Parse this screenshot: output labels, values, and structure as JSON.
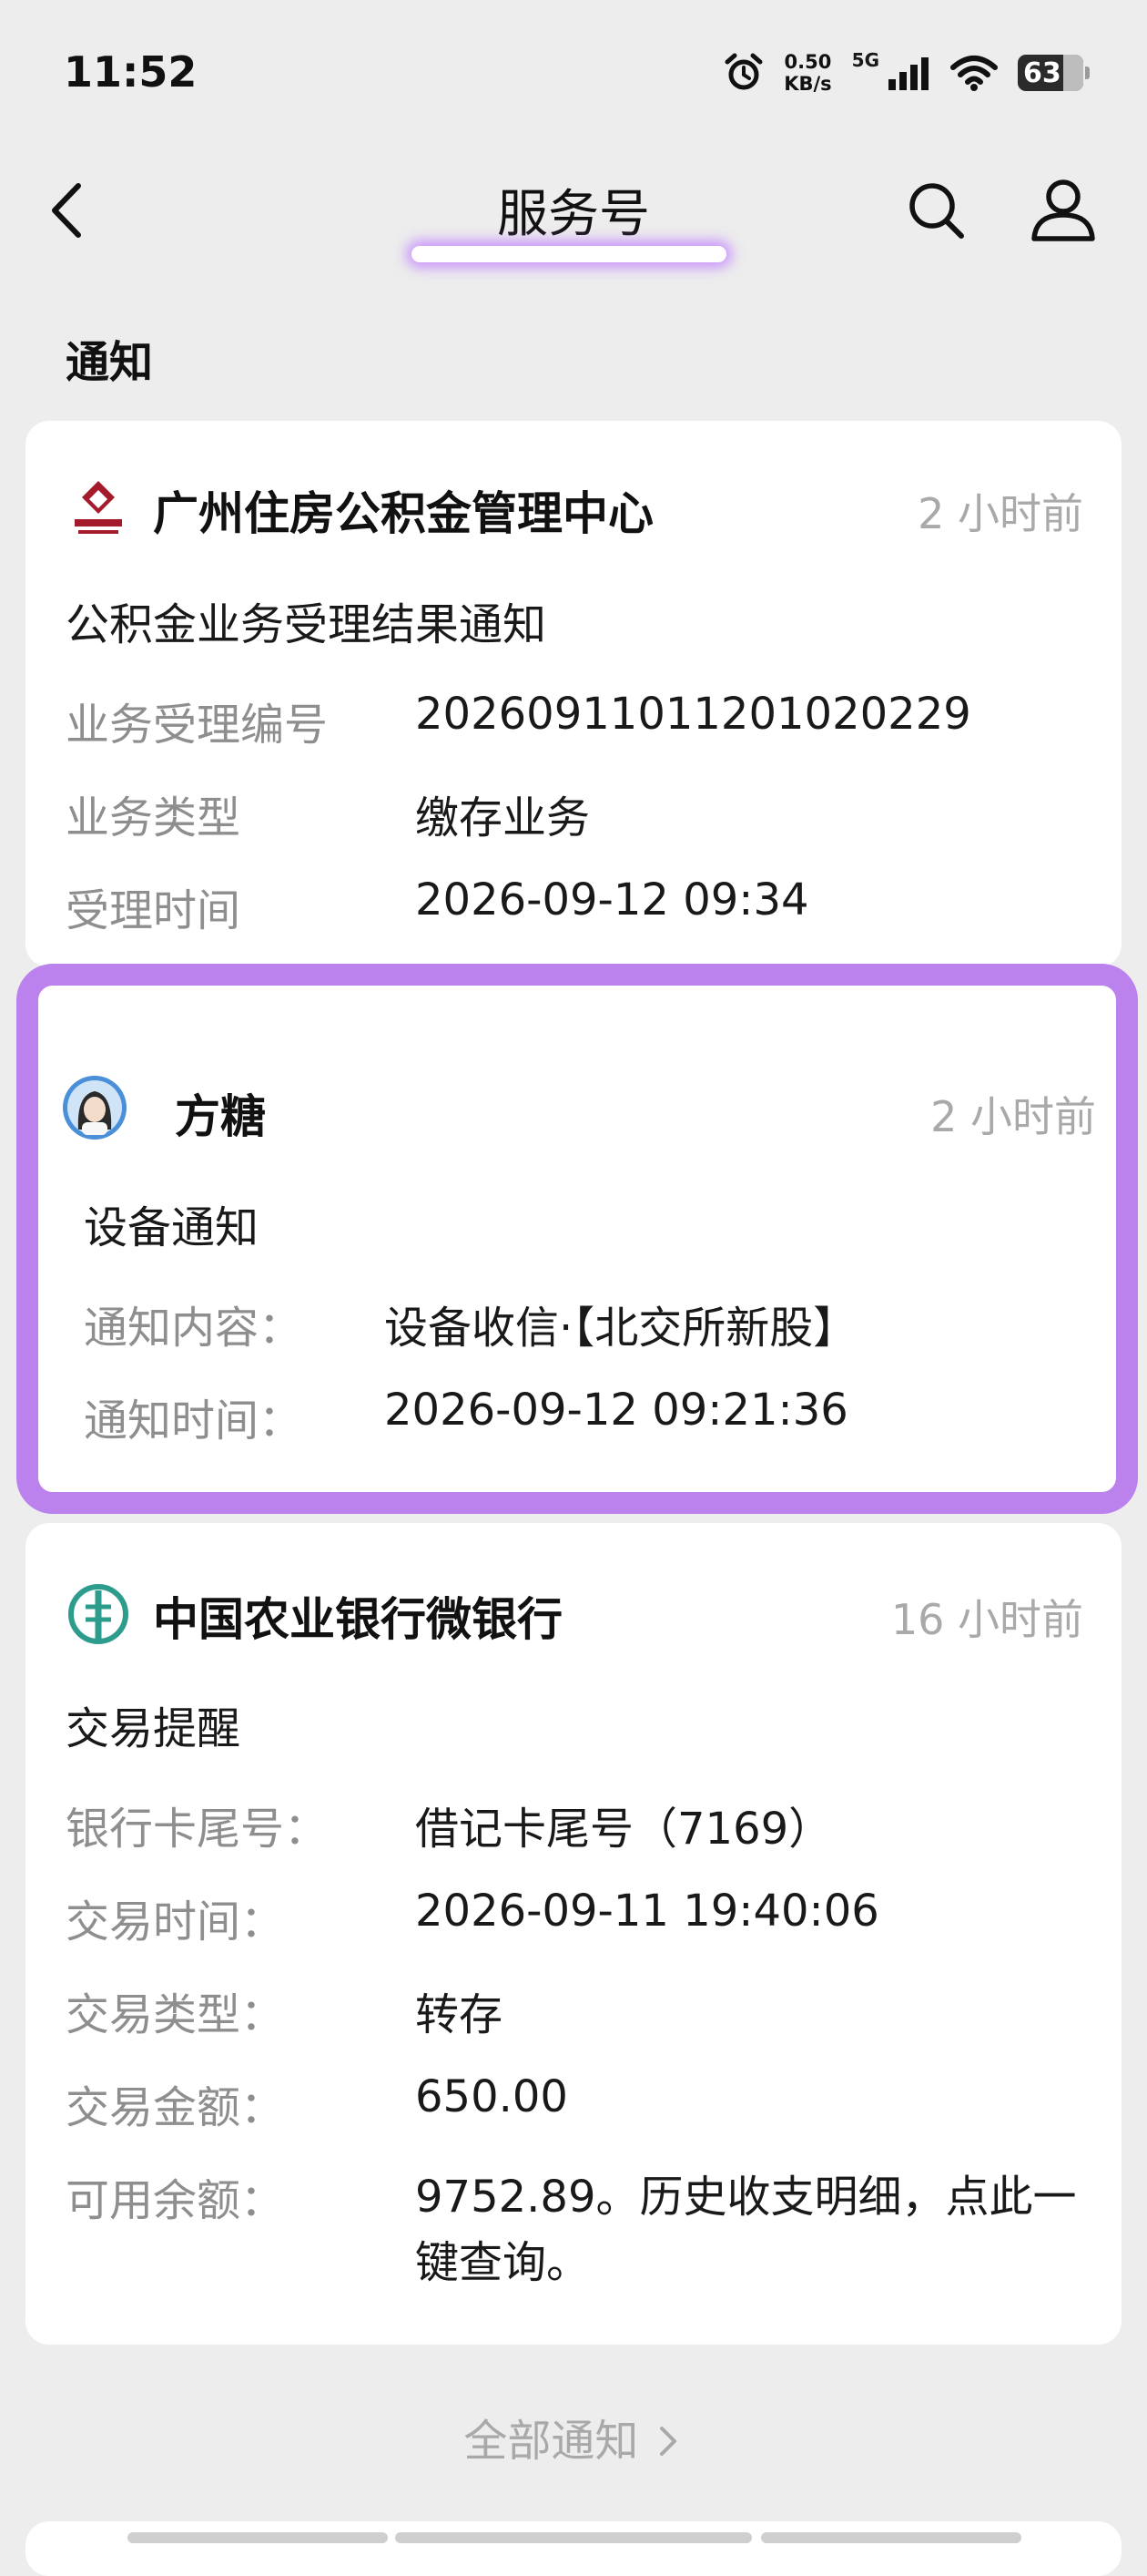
{
  "status_bar": {
    "time": "11:52",
    "net_speed_value": "0.50",
    "net_speed_unit": "KB/s",
    "signal_label": "5G",
    "battery": "63"
  },
  "nav": {
    "title": "服务号"
  },
  "section_title": "通知",
  "cards": [
    {
      "sender": "广州住房公积金管理中心",
      "time_ago": "2 小时前",
      "title": "公积金业务受理结果通知",
      "fields": [
        {
          "label": "业务受理编号",
          "value": "202609110112010202​29"
        },
        {
          "label": "业务类型",
          "value": "缴存业务"
        },
        {
          "label": "受理时间",
          "value": "2026-09-12 09:34"
        }
      ]
    },
    {
      "sender": "方糖",
      "time_ago": "2 小时前",
      "title": "设备通知",
      "fields": [
        {
          "label": "通知内容：",
          "value": "设备收信·【北交所新股】"
        },
        {
          "label": "通知时间：",
          "value": "2026-09-12 09:21:36"
        }
      ]
    },
    {
      "sender": "中国农业银行微银行",
      "time_ago": "16 小时前",
      "title": "交易提醒",
      "fields": [
        {
          "label": "银行卡尾号：",
          "value": "借记卡尾号（7169）"
        },
        {
          "label": "交易时间：",
          "value": "2026-09-11 19:40:06"
        },
        {
          "label": "交易类型：",
          "value": "转存"
        },
        {
          "label": "交易金额：",
          "value": "650.00"
        },
        {
          "label": "可用余额：",
          "value": "9752.89。历史收支明细，点此一键查询。"
        }
      ]
    }
  ],
  "all_notifications": "全部通知",
  "colors": {
    "highlight": "#bb82ee",
    "background": "#ededed",
    "label_gray": "#8e8e8e",
    "time_gray": "#a9a9a9"
  },
  "icons": [
    "back-arrow-icon",
    "search-icon",
    "profile-icon",
    "alarm-icon",
    "signal-icon",
    "wifi-icon",
    "battery-icon",
    "chevron-right-icon"
  ]
}
